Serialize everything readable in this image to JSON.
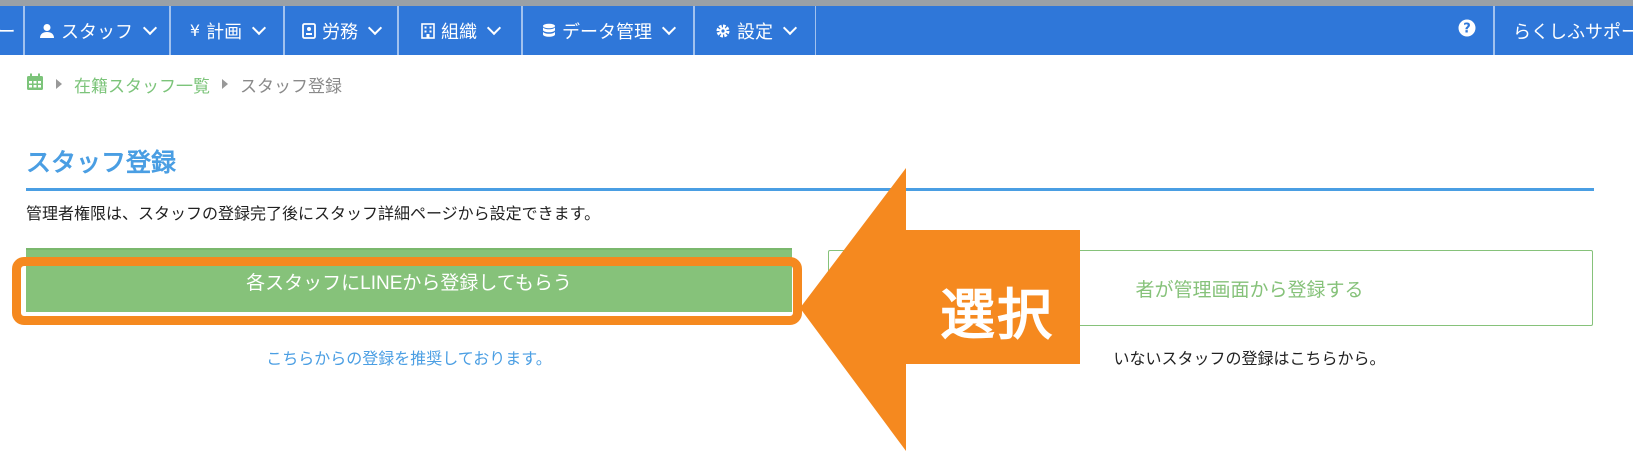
{
  "navbar": {
    "left_edge_glyph": "ー",
    "items": [
      {
        "icon": "user-icon",
        "label": "スタッフ"
      },
      {
        "icon": "yen-icon",
        "label": "計画"
      },
      {
        "icon": "badge-icon",
        "label": "労務"
      },
      {
        "icon": "building-icon",
        "label": "組織"
      },
      {
        "icon": "database-icon",
        "label": "データ管理"
      },
      {
        "icon": "gear-icon",
        "label": "設定"
      }
    ],
    "help_icon": "question-circle-icon",
    "account_label": "らくしふサポー"
  },
  "breadcrumb": {
    "icon": "calendar-icon",
    "link": "在籍スタッフ一覧",
    "current": "スタッフ登録"
  },
  "page": {
    "title": "スタッフ登録",
    "note": "管理者権限は、スタッフの登録完了後にスタッフ詳細ページから設定できます。",
    "line_button": "各スタッフにLINEから登録してもらう",
    "line_help": "こちらからの登録を推奨しております。",
    "admin_button": "者が管理画面から登録する",
    "admin_help": "いないスタッフの登録はこちらから。"
  },
  "annotation": {
    "label": "選択",
    "color": "#f5891f"
  },
  "colors": {
    "nav": "#2f77d9",
    "accent_blue": "#4a9ee3",
    "line_green": "#86c27a"
  }
}
